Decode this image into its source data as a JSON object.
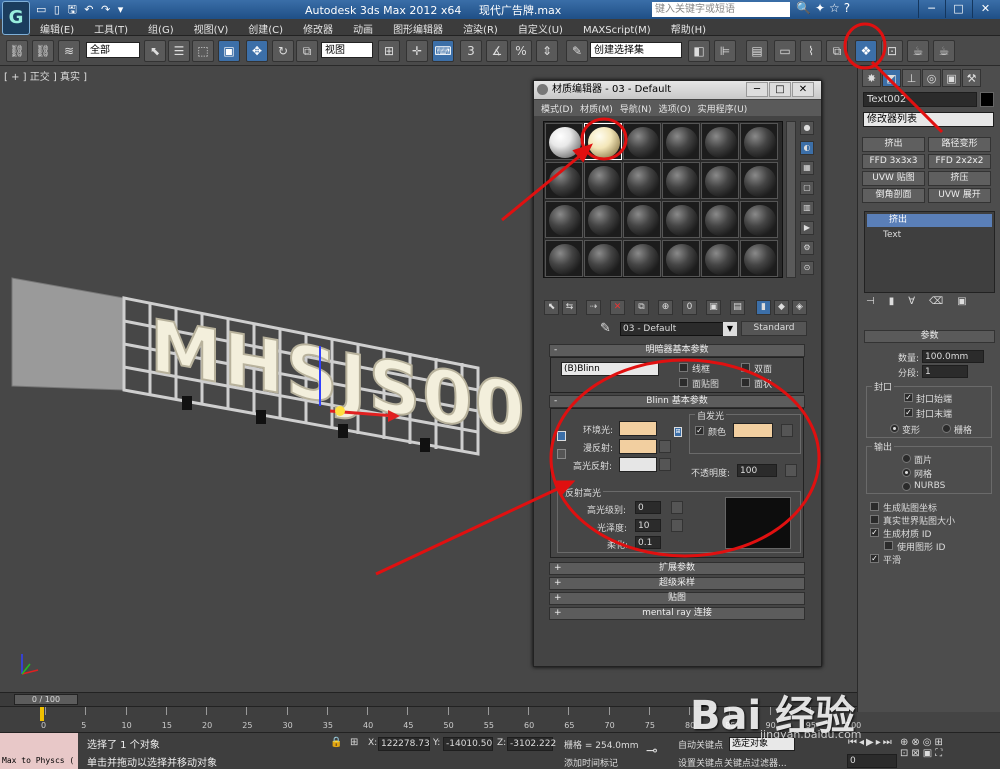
{
  "titlebar": {
    "app_title": "Autodesk 3ds Max  2012 x64",
    "file_name": "现代广告牌.max",
    "search_placeholder": "键入关键字或短语",
    "logo": "G",
    "win_min": "─",
    "win_max": "□",
    "win_close": "✕"
  },
  "menu": [
    "编辑(E)",
    "工具(T)",
    "组(G)",
    "视图(V)",
    "创建(C)",
    "修改器",
    "动画",
    "图形编辑器",
    "渲染(R)",
    "自定义(U)",
    "MAXScript(M)",
    "帮助(H)"
  ],
  "toolbar": {
    "selection_filter": "全部",
    "ref_coord": "视图",
    "named_selection": "创建选择集",
    "num_3": "3"
  },
  "viewport": {
    "label": "[ + ] 正交 ] 真实 ]",
    "scene_text": "MHSJS001"
  },
  "material_editor": {
    "title": "材质编辑器 - 03 - Default",
    "menu": [
      "模式(D)",
      "材质(M)",
      "导航(N)",
      "选项(O)",
      "实用程序(U)"
    ],
    "material_name": "03 - Default",
    "material_type": "Standard",
    "shader_basic_title": "明暗器基本参数",
    "shader": "(B)Blinn",
    "wire": "线框",
    "two_sided": "双面",
    "face_map": "面贴图",
    "faceted": "面状",
    "blinn_title": "Blinn 基本参数",
    "self_illum": "自发光",
    "color_label": "颜色",
    "ambient": "环境光:",
    "diffuse": "漫反射:",
    "specular": "高光反射:",
    "opacity_label": "不透明度:",
    "opacity": "100",
    "spec_highlights": "反射高光",
    "spec_level_label": "高光级别:",
    "spec_level": "0",
    "gloss_label": "光泽度:",
    "gloss": "10",
    "soften_label": "柔化:",
    "soften": "0.1",
    "rollouts": [
      "扩展参数",
      "超级采样",
      "贴图",
      "mental ray 连接"
    ],
    "colors": {
      "ambient": "#f2cfa0",
      "diffuse": "#f2cfa0",
      "specular": "#e6e6e6",
      "self_illum": "#f2cfa0"
    }
  },
  "command_panel": {
    "object_name": "Text002",
    "modifier_list": "修改器列表",
    "buttons": [
      "挤出",
      "路径变形",
      "FFD 3x3x3",
      "FFD 2x2x2",
      "UVW 贴图",
      "挤压",
      "倒角剖面",
      "UVW 展开"
    ],
    "stack_selected": "挤出",
    "stack_sub": "Text",
    "params_title": "参数",
    "amount_label": "数量:",
    "amount": "100.0mm",
    "segments_label": "分段:",
    "segments": "1",
    "capping": "封口",
    "cap_start": "封口始端",
    "cap_end": "封口末端",
    "morph": "变形",
    "grid": "栅格",
    "output": "输出",
    "patch": "面片",
    "mesh": "网格",
    "nurbs": "NURBS",
    "gen_map_coords": "生成贴图坐标",
    "real_world": "真实世界贴图大小",
    "gen_mat_ids": "生成材质 ID",
    "use_shape_ids": "使用图形 ID",
    "smooth": "平滑"
  },
  "timeline": {
    "frame": "0 / 100",
    "ticks": [
      "0",
      "5",
      "10",
      "15",
      "20",
      "25",
      "30",
      "35",
      "40",
      "45",
      "50",
      "55",
      "60",
      "65",
      "70",
      "75",
      "80",
      "85",
      "90",
      "95",
      "100"
    ]
  },
  "status": {
    "script_box": "Max to Physcs (",
    "msg_selected": "选择了 1 个对象",
    "msg_hint": "单击并拖动以选择并移动对象",
    "x_label": "X:",
    "x": "122278.73",
    "y_label": "Y:",
    "y": "-14010.50",
    "z_label": "Z:",
    "z": "-3102.222",
    "grid_label": "栅格 = 254.0mm",
    "add_time_tag": "添加时间标记",
    "auto_key": "自动关键点",
    "set_key": "设置关键点",
    "selected_obj": "选定对象",
    "key_filters": "关键点过滤器...",
    "frame_field": "0"
  },
  "watermark": {
    "logo_text": "Bai  经验",
    "url": "jingyan.baidu.com"
  }
}
